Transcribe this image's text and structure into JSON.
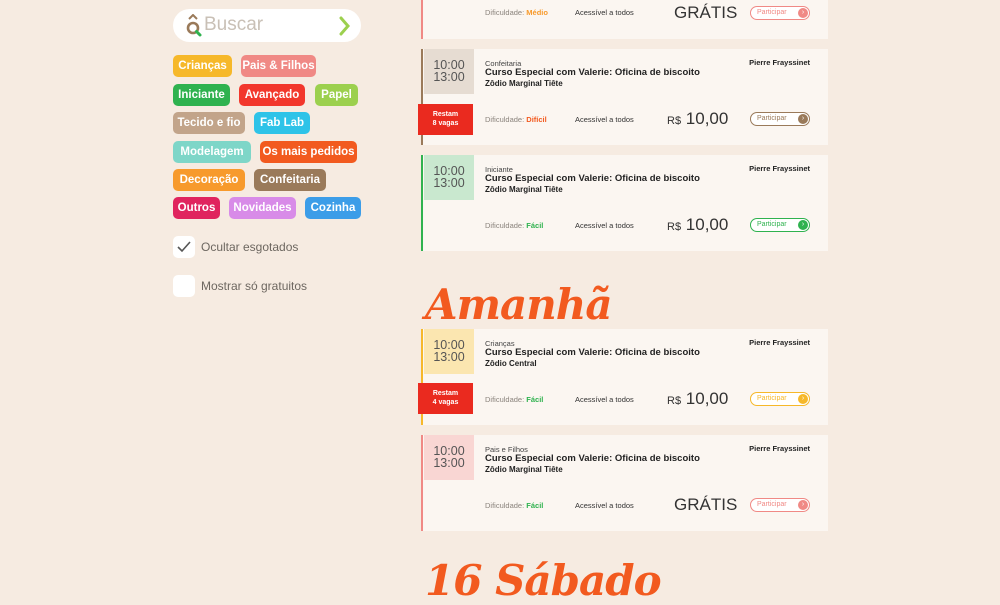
{
  "search": {
    "placeholder": "Buscar"
  },
  "categories": [
    {
      "label": "Crianças",
      "color": "#f6b82a"
    },
    {
      "label": "Pais & Filhos",
      "color": "#f08985"
    },
    {
      "label": "Iniciante",
      "color": "#2fb24f"
    },
    {
      "label": "Avançado",
      "color": "#f2372c"
    },
    {
      "label": "Papel",
      "color": "#9cd04e"
    },
    {
      "label": "Tecido e fio",
      "color": "#c2a48a"
    },
    {
      "label": "Fab Lab",
      "color": "#2ec3e8"
    },
    {
      "label": "Modelagem",
      "color": "#7ed6c8"
    },
    {
      "label": "Os mais pedidos",
      "color": "#f25a1f"
    },
    {
      "label": "Decoração",
      "color": "#f79a2c"
    },
    {
      "label": "Confeitaria",
      "color": "#9a7a5a"
    },
    {
      "label": "Outros",
      "color": "#e0245e"
    },
    {
      "label": "Novidades",
      "color": "#d88be8"
    },
    {
      "label": "Cozinha",
      "color": "#3c9de8"
    }
  ],
  "filters": {
    "hide_sold_out": {
      "label": "Ocultar esgotados",
      "checked": true
    },
    "only_free": {
      "label": "Mostrar só gratuitos",
      "checked": false
    }
  },
  "top_partial_event": {
    "difficulty_label": "Dificuldade:",
    "difficulty": "Médio",
    "access": "Acessível a todos",
    "price": "GRÁTIS",
    "button": "Participar"
  },
  "events": [
    {
      "start": "10:00",
      "end": "13:00",
      "category": "Confeitaria",
      "title": "Curso Especial com Valerie: Oficina de biscoito",
      "place": "Zôdio Marginal Tiête",
      "instructor": "Pierre Frayssinet",
      "spots_line1": "Restam",
      "spots_line2": "8 vagas",
      "difficulty_label": "Dificuldade:",
      "difficulty": "Difícil",
      "access": "Acessível a todos",
      "currency": "R$",
      "price": "10,00",
      "button": "Participar"
    },
    {
      "start": "10:00",
      "end": "13:00",
      "category": "Iniciante",
      "title": "Curso Especial com Valerie: Oficina de biscoito",
      "place": "Zôdio Marginal Tiête",
      "instructor": "Pierre Frayssinet",
      "difficulty_label": "Dificuldade:",
      "difficulty": "Fácil",
      "access": "Acessível a todos",
      "currency": "R$",
      "price": "10,00",
      "button": "Participar"
    },
    {
      "start": "10:00",
      "end": "13:00",
      "category": "Crianças",
      "title": "Curso Especial com Valerie: Oficina de biscoito",
      "place": "Zôdio Central",
      "instructor": "Pierre Frayssinet",
      "spots_line1": "Restam",
      "spots_line2": "4 vagas",
      "difficulty_label": "Dificuldade:",
      "difficulty": "Fácil",
      "access": "Acessível a todos",
      "currency": "R$",
      "price": "10,00",
      "button": "Participar"
    },
    {
      "start": "10:00",
      "end": "13:00",
      "category": "Pais e Filhos",
      "title": "Curso Especial com Valerie: Oficina de biscoito",
      "place": "Zôdio Marginal Tiête",
      "instructor": "Pierre Frayssinet",
      "difficulty_label": "Dificuldade:",
      "difficulty": "Fácil",
      "access": "Acessível a todos",
      "price": "GRÁTIS",
      "button": "Participar"
    }
  ],
  "headings": {
    "tomorrow": "Amanhã",
    "saturday": "16 Sábado"
  },
  "colors": {
    "accent_orange": "#f25a1f",
    "difficulty_hard": "#f25a1f",
    "difficulty_easy": "#2fb24f",
    "difficulty_medium": "#f79a2c"
  }
}
